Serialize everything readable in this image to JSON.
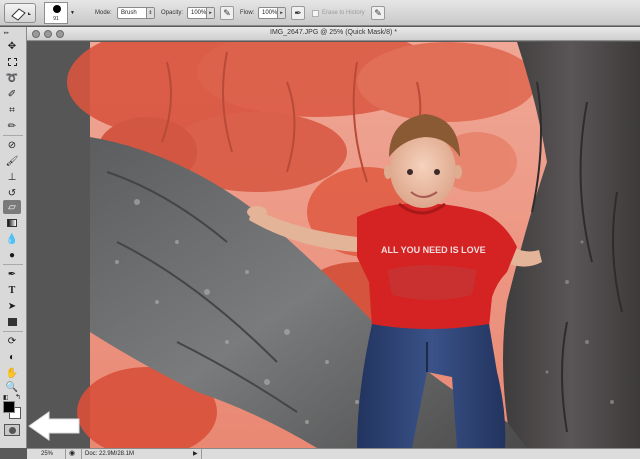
{
  "options_bar": {
    "brush_size": "91",
    "mode_label": "Mode:",
    "mode_value": "Brush",
    "opacity_label": "Opacity:",
    "opacity_value": "100%",
    "flow_label": "Flow:",
    "flow_value": "100%",
    "erase_to_history_label": "Erase to History"
  },
  "document": {
    "title": "IMG_2647.JPG @ 25% (Quick Mask/8) *",
    "shirt_text": "ALL YOU NEED IS LOVE"
  },
  "status_bar": {
    "zoom": "25%",
    "doc_size": "Doc: 22.9M/28.1M"
  },
  "toolbox": {
    "tools": [
      "move-tool",
      "marquee-tool",
      "lasso-tool",
      "quick-selection-tool",
      "crop-tool",
      "eyedropper-tool",
      "healing-brush-tool",
      "brush-tool",
      "clone-stamp-tool",
      "history-brush-tool",
      "eraser-tool",
      "gradient-tool",
      "blur-tool",
      "dodge-tool",
      "pen-tool",
      "type-tool",
      "path-selection-tool",
      "shape-tool",
      "3d-rotate-tool",
      "3d-orbit-tool",
      "hand-tool",
      "zoom-tool"
    ],
    "active_tool": "eraser-tool",
    "foreground_color": "#000000",
    "background_color": "#ffffff"
  },
  "colors": {
    "quick_mask_overlay": "#e8483a",
    "shirt": "#d42020",
    "jeans": "#2c3f6e"
  }
}
